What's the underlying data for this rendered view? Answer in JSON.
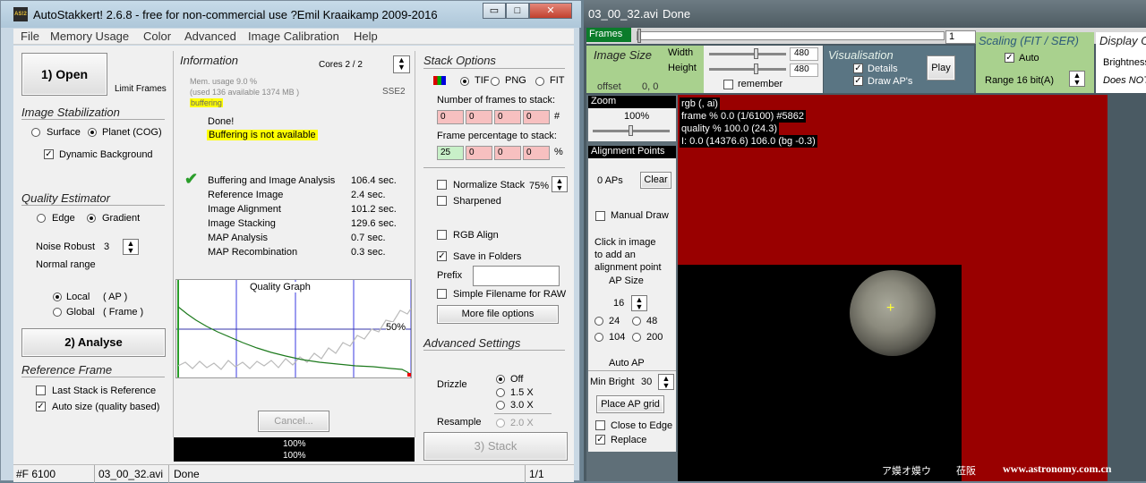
{
  "left_window": {
    "title": "AutoStakkert! 2.6.8 - free for non-commercial use ?Emil Kraaikamp 2009-2016",
    "icon_text": "AS!2",
    "caption": {
      "min": "▭",
      "max": "□",
      "close": "✕"
    },
    "menu": [
      "File",
      "Memory Usage",
      "Color",
      "Advanced",
      "Image Calibration",
      "Help"
    ],
    "open_btn": "1) Open",
    "limit_frames": "Limit Frames",
    "image_stabilization": "Image Stabilization",
    "surface": "Surface",
    "planet": "Planet (COG)",
    "dynamic_bg": "Dynamic Background",
    "quality_estimator": "Quality Estimator",
    "edge": "Edge",
    "gradient": "Gradient",
    "noise_robust": "Noise Robust",
    "noise_value": "3",
    "normal_range": "Normal range",
    "local": "Local",
    "local_ap": "( AP )",
    "global": "Global",
    "global_frame": "( Frame )",
    "analyse_btn": "2) Analyse",
    "reference_frame": "Reference Frame",
    "last_stack_ref": "Last Stack is Reference",
    "auto_size": "Auto size (quality based)",
    "information": "Information",
    "cores": "Cores 2 / 2",
    "mem_usage": "Mem. usage 9.0 %",
    "mem_detail": "(used 136 available 1374 MB )",
    "buffering_small": "buffering",
    "sse2": "SSE2",
    "done": "Done!",
    "buffering_na": "Buffering is not available",
    "timings": [
      {
        "label": "Buffering and Image Analysis",
        "value": "106.4 sec."
      },
      {
        "label": "Reference Image",
        "value": "2.4 sec."
      },
      {
        "label": "Image Alignment",
        "value": "101.2 sec."
      },
      {
        "label": "Image Stacking",
        "value": "129.6 sec."
      },
      {
        "label": "MAP Analysis",
        "value": "0.7 sec."
      },
      {
        "label": "MAP Recombination",
        "value": "0.3 sec."
      }
    ],
    "quality_graph": "Quality Graph",
    "graph_pct": "50%",
    "cancel_btn": "Cancel...",
    "progress1": "100%",
    "progress2": "100%",
    "stack_options": "Stack Options",
    "tif": "TIF",
    "png": "PNG",
    "fit": "FIT",
    "num_frames_label": "Number of frames to stack:",
    "num_frames": [
      "0",
      "0",
      "0",
      "0"
    ],
    "num_suffix": "#",
    "frame_pct_label": "Frame percentage to stack:",
    "frame_pct": [
      "25",
      "0",
      "0",
      "0"
    ],
    "pct_suffix": "%",
    "normalize_stack": "Normalize Stack",
    "normalize_value": "75%",
    "sharpened": "Sharpened",
    "rgb_align": "RGB Align",
    "save_in_folders": "Save in Folders",
    "prefix": "Prefix",
    "prefix_value": "",
    "simple_filename": "Simple Filename for RAW",
    "more_file_options": "More file options",
    "advanced_settings": "Advanced Settings",
    "drizzle": "Drizzle",
    "drizzle_off": "Off",
    "drizzle_15": "1.5 X",
    "drizzle_30": "3.0 X",
    "resample": "Resample",
    "resample_20": "2.0 X",
    "stack_btn": "3) Stack",
    "status_frames": "#F 6100",
    "status_file": "03_00_32.avi",
    "status_state": "Done",
    "status_page": "1/1"
  },
  "right_window": {
    "title": "03_00_32.avi",
    "title_state": "Done",
    "frames_tab": "Frames",
    "frame_index": "1",
    "image_size": "Image Size",
    "width_label": "Width",
    "height_label": "Height",
    "width_value": "480",
    "height_value": "480",
    "remember": "remember",
    "offset": "offset",
    "offset_value": "0, 0",
    "visualisation": "Visualisation",
    "details": "Details",
    "draw_aps": "Draw AP's",
    "play": "Play",
    "scaling": "Scaling (FIT / SER)",
    "auto": "Auto",
    "range": "Range 16 bit(A)",
    "display": "Display O",
    "brightness": "Brightness",
    "does_not": "Does NOT",
    "zoom": "Zoom",
    "zoom_value": "100%",
    "alignment_points": "Alignment Points",
    "aps_count": "0 APs",
    "clear": "Clear",
    "manual_draw": "Manual Draw",
    "click_help": [
      "Click in image",
      "to add an",
      "alignment point"
    ],
    "ap_size": "AP Size",
    "ap_size_value": "16",
    "ap_24": "24",
    "ap_48": "48",
    "ap_104": "104",
    "ap_200": "200",
    "auto_ap": "Auto AP",
    "min_bright": "Min Bright",
    "min_bright_value": "30",
    "place_ap_grid": "Place AP grid",
    "close_to_edge": "Close to Edge",
    "replace": "Replace",
    "overlay": [
      "rgb (, ai)",
      "frame % 0.0 (1/6100) #5862",
      "quality % 100.0  (24.3)",
      "I: 0.0 (14376.6) 106.0 (bg -0.3)"
    ],
    "watermark_left": "ア嫫オ嫫ウ",
    "watermark_mid": "莅阪",
    "watermark_right": "www.astronomy.com.cn"
  },
  "colors": {
    "frame_red": "#990000",
    "panel_green": "#a9d18e",
    "dark_side": "#5f6f78"
  }
}
